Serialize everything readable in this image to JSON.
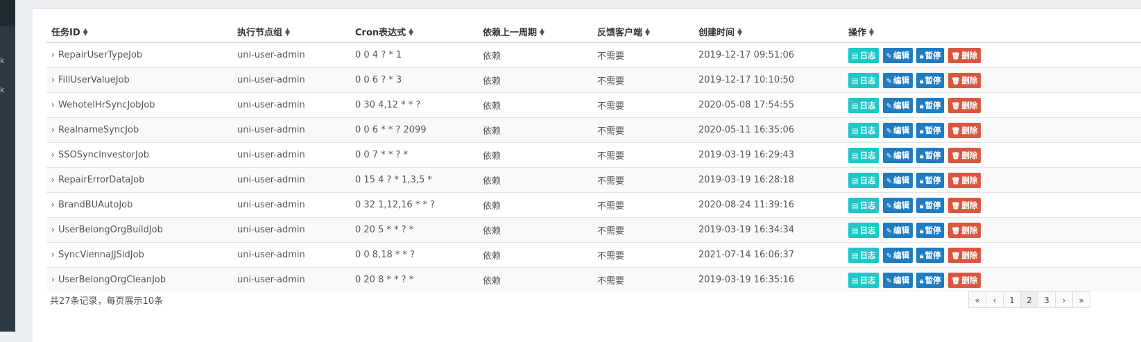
{
  "sidebar": {
    "marks": [
      "k",
      "k"
    ]
  },
  "table": {
    "headers": [
      "任务ID",
      "执行节点组",
      "Cron表达式",
      "依赖上一周期",
      "反馈客户端",
      "创建时间",
      "操作"
    ],
    "rows": [
      {
        "id": "RepairUserTypeJob",
        "group": "uni-user-admin",
        "cron": "0 0 4 ? * 1",
        "dep": "依赖",
        "feedback": "不需要",
        "created": "2019-12-17 09:51:06"
      },
      {
        "id": "FillUserValueJob",
        "group": "uni-user-admin",
        "cron": "0 0 6 ? * 3",
        "dep": "依赖",
        "feedback": "不需要",
        "created": "2019-12-17 10:10:50"
      },
      {
        "id": "WehotelHrSyncJobJob",
        "group": "uni-user-admin",
        "cron": "0 30 4,12 * * ?",
        "dep": "依赖",
        "feedback": "不需要",
        "created": "2020-05-08 17:54:55"
      },
      {
        "id": "RealnameSyncJob",
        "group": "uni-user-admin",
        "cron": "0 0 6 * * ? 2099",
        "dep": "依赖",
        "feedback": "不需要",
        "created": "2020-05-11 16:35:06"
      },
      {
        "id": "SSOSyncInvestorJob",
        "group": "uni-user-admin",
        "cron": "0 0 7 * * ? *",
        "dep": "依赖",
        "feedback": "不需要",
        "created": "2019-03-19 16:29:43"
      },
      {
        "id": "RepairErrorDataJob",
        "group": "uni-user-admin",
        "cron": "0 15 4 ? * 1,3,5 *",
        "dep": "依赖",
        "feedback": "不需要",
        "created": "2019-03-19 16:28:18"
      },
      {
        "id": "BrandBUAutoJob",
        "group": "uni-user-admin",
        "cron": "0 32 1,12,16 * * ?",
        "dep": "依赖",
        "feedback": "不需要",
        "created": "2020-08-24 11:39:16"
      },
      {
        "id": "UserBelongOrgBuildJob",
        "group": "uni-user-admin",
        "cron": "0 20 5 * * ? *",
        "dep": "依赖",
        "feedback": "不需要",
        "created": "2019-03-19 16:34:34"
      },
      {
        "id": "SyncViennaJJSidJob",
        "group": "uni-user-admin",
        "cron": "0 0 8,18 * * ?",
        "dep": "依赖",
        "feedback": "不需要",
        "created": "2021-07-14 16:06:37"
      },
      {
        "id": "UserBelongOrgCleanJob",
        "group": "uni-user-admin",
        "cron": "0 20 8 * * ? *",
        "dep": "依赖",
        "feedback": "不需要",
        "created": "2019-03-19 16:35:16"
      }
    ]
  },
  "actions": {
    "log": "日志",
    "edit": "编辑",
    "pause": "暂停",
    "delete": "删除"
  },
  "footer": {
    "summary": "共27条记录，每页展示10条"
  },
  "pagination": {
    "items": [
      "«",
      "‹",
      "1",
      "2",
      "3",
      "›",
      "»"
    ],
    "active": "2"
  },
  "colors": {
    "log": "#1fc7c7",
    "edit": "#1f7cc1",
    "pause": "#1f7cc1",
    "delete": "#d9573f"
  }
}
